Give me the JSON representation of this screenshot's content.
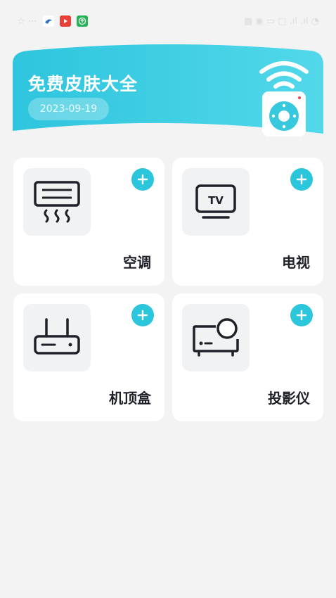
{
  "status_bar": {
    "left_text": "…",
    "right_text": "…"
  },
  "header": {
    "title": "免费皮肤大全",
    "date": "2023-09-19",
    "gradient_start": "#2ec5de",
    "gradient_end": "#4fd7ea",
    "icon": "remote-wifi-icon"
  },
  "devices": [
    {
      "label": "空调",
      "icon": "air-conditioner-icon"
    },
    {
      "label": "电视",
      "icon": "tv-icon",
      "icon_text": "TV"
    },
    {
      "label": "机顶盒",
      "icon": "set-top-box-icon"
    },
    {
      "label": "投影仪",
      "icon": "projector-icon"
    }
  ],
  "colors": {
    "accent": "#2cc6dc",
    "background": "#f3f3f3",
    "card": "#ffffff",
    "text": "#1f2129"
  }
}
